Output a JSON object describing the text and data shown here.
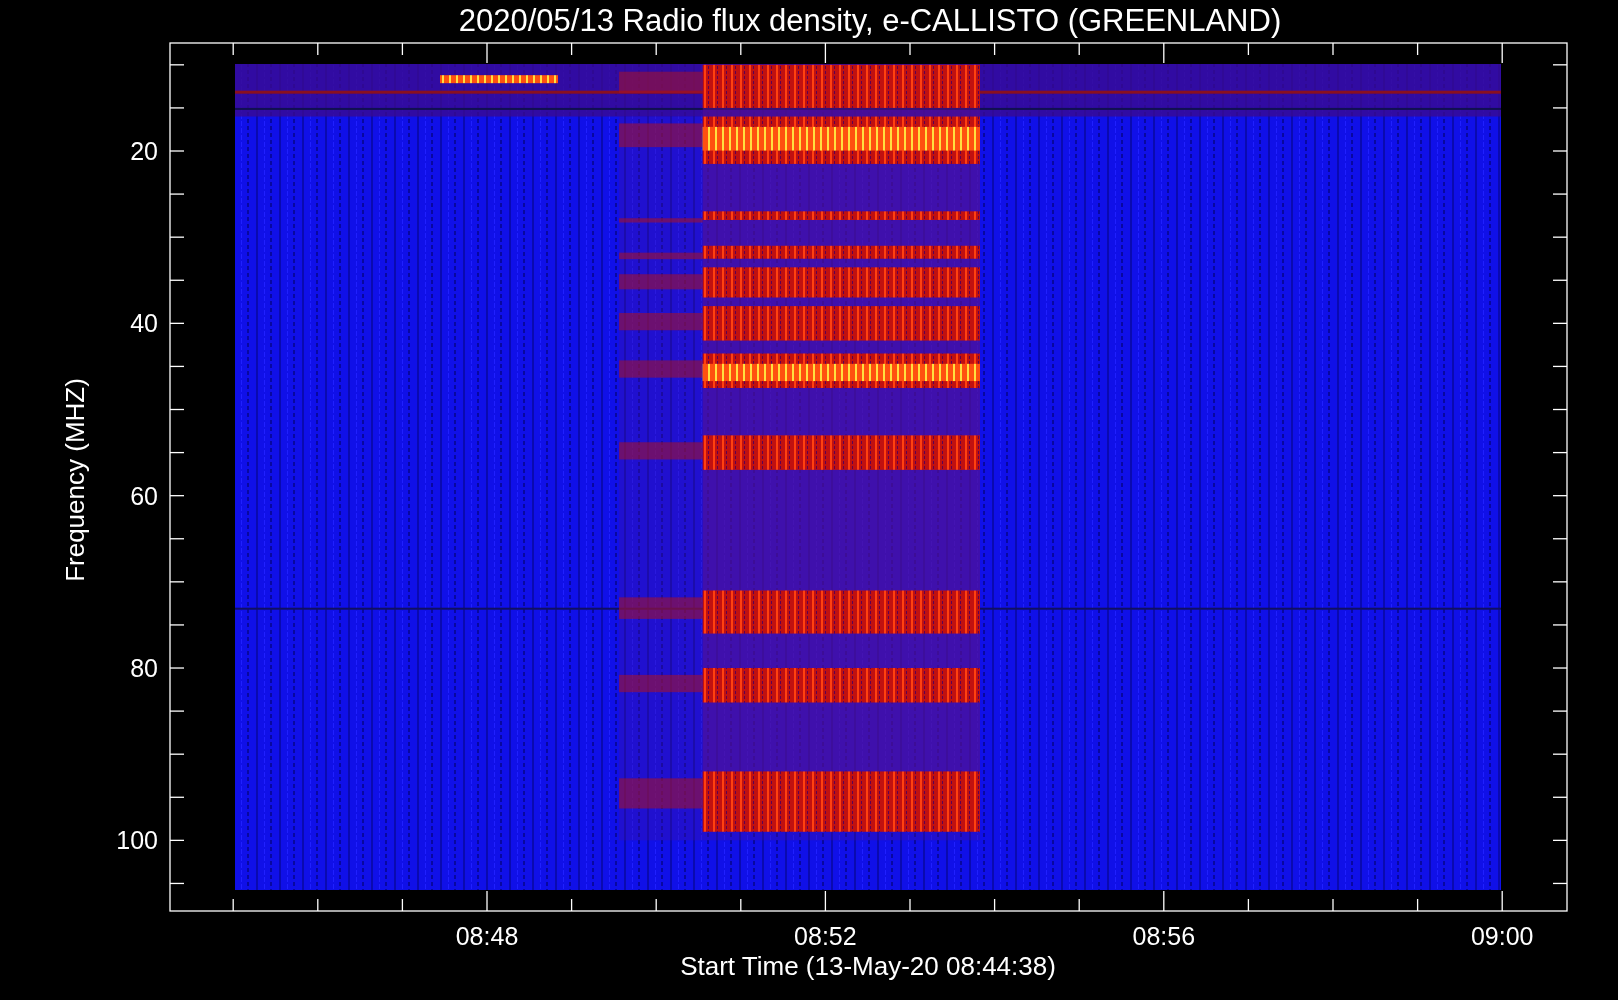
{
  "plot": {
    "title": "2020/05/13  Radio flux density, e-CALLISTO (GREENLAND)",
    "ylabel": "Frequency (MHZ)",
    "xlabel": "Start Time (13-May-20 08:44:38)",
    "y_tick_labels": [
      "20",
      "40",
      "60",
      "80",
      "100"
    ],
    "x_tick_labels": [
      "08:48",
      "08:52",
      "08:56",
      "09:00"
    ]
  }
}
